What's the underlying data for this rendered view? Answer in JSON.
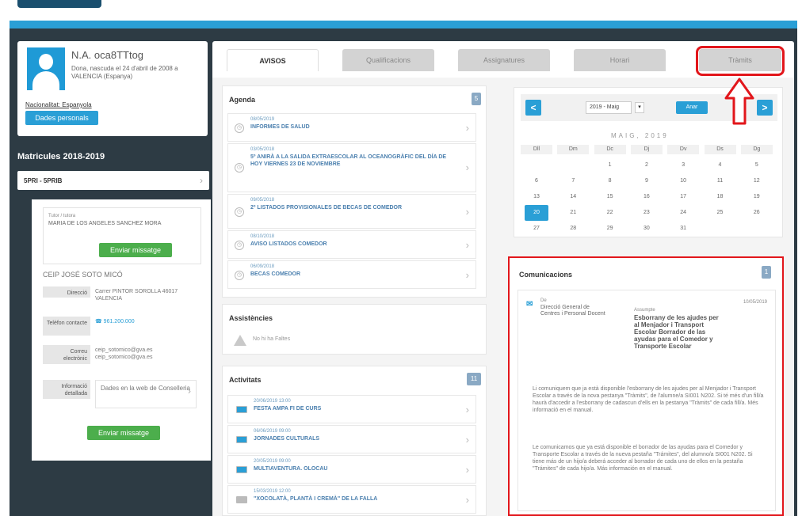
{
  "profile": {
    "name": "N.A. oca8TTtog",
    "born": "Dona, nascuda el 24 d'abril de 2008 a VALENCIA (Espanya)",
    "nationality": "Nacionalitat: Espanyola",
    "personal_data_button": "Dades personals"
  },
  "enrollments": {
    "title": "Matricules 2018-2019",
    "level": "5PRI - 5PRIB",
    "tutor_label": "Tutor / tutora",
    "tutor_name": "MARIA DE LOS ANGELES SANCHEZ MORA",
    "send_message": "Enviar missatge",
    "school": "CEIP JOSÉ SOTO MICÓ",
    "direction_key": "Direcció",
    "direction_val": "Carrer PINTOR SOROLLA 46017 VALENCIA",
    "phone_key": "Telèfon contacte",
    "phone_val": "961.200.000",
    "email_key": "Correu electrònic",
    "email_val1": "ceip_sotomico@gva.es",
    "email_val2": "ceip_sotomico@gva.es",
    "info_key": "Informació detallada",
    "info_val": "Dades en la web de Conselleria",
    "send_message2": "Enviar missatge"
  },
  "tabs": [
    "AVISOS",
    "Qualificacions",
    "Assignatures",
    "Horari",
    "Tràmits"
  ],
  "agenda": {
    "title": "Agenda",
    "badge": "5",
    "items": [
      {
        "date": "08/05/2019",
        "title": "INFORMES DE SALUD"
      },
      {
        "date": "03/05/2018",
        "title": "5º ANIRÀ A LA SALIDA EXTRAESCOLAR AL OCEANOGRÀFIC DEL DÍA DE HOY VIERNES 23 DE NOVIEMBRE"
      },
      {
        "date": "09/05/2018",
        "title": "2º LISTADOS PROVISIONALES DE BECAS DE COMEDOR"
      },
      {
        "date": "08/10/2018",
        "title": "AVISO LISTADOS COMEDOR"
      },
      {
        "date": "06/09/2018",
        "title": "BECAS COMEDOR"
      }
    ]
  },
  "assistencies": {
    "title": "Assistències",
    "empty": "No hi ha Faltes"
  },
  "activitats": {
    "title": "Activitats",
    "badge": "11",
    "items": [
      {
        "date": "20/06/2019 13:00",
        "title": "FESTA AMPA FI DE CURS"
      },
      {
        "date": "06/06/2019 09:00",
        "title": "JORNADES CULTURALS"
      },
      {
        "date": "20/05/2019 09:00",
        "title": "MULTIAVENTURA. OLOCAU"
      },
      {
        "date": "15/03/2019 12:00",
        "title": "\"XOCOLATÀ, PLANTÀ I CREMÀ\" DE LA FALLA"
      }
    ]
  },
  "calendar": {
    "prev": "<",
    "next": ">",
    "select_value": "2019 - Maig",
    "go_button": "Anar",
    "month_label": "MAIG, 2019",
    "weekdays": [
      "Dll",
      "Dm",
      "Dc",
      "Dj",
      "Dv",
      "Ds",
      "Dg"
    ],
    "days": [
      "",
      "",
      "1",
      "2",
      "3",
      "4",
      "5",
      "6",
      "7",
      "8",
      "9",
      "10",
      "11",
      "12",
      "13",
      "14",
      "15",
      "16",
      "17",
      "18",
      "19",
      "20",
      "21",
      "22",
      "23",
      "24",
      "25",
      "26",
      "27",
      "28",
      "29",
      "30",
      "31",
      "",
      ""
    ],
    "today": "20"
  },
  "comunicacions": {
    "title": "Comunicacions",
    "badge": "1",
    "from_label": "De",
    "from": "Direcció General de Centres i Personal Docent",
    "subject_label": "Assumpte",
    "subject": "Esborrany de les ajudes per al Menjador i Transport Escolar Borrador de las ayudas para el Comedor y Transporte Escolar",
    "date": "10/05/2019",
    "para1": "Li comuniquem que ja està disponible l'esborrany de les ajudes per al Menjador i Transport Escolar a través de la nova pestanya \"Tràmits\", de l'alumne/a SI001 N202. Si té més d'un fill/a haurà d'accedir a l'esborrany de cadascun d'ells en la pestanya \"Tràmits\" de cada fill/a. Més informació en el manual.",
    "para2": "Le comunicamos que ya está disponible el borrador de las ayudas para el Comedor y Transporte Escolar a través de la nueva pestaña \"Trámites\", del alumno/a SI001 N202. Si tiene más de un hijo/a deberá acceder al borrador de cada uno de ellos en la pestaña \"Trámites\" de cada hijo/a. Más información en el manual."
  },
  "colors": {
    "accent": "#2a9fd6",
    "dark_bg": "#2d3b44",
    "highlight": "#e2161b",
    "green": "#4cae4c"
  }
}
